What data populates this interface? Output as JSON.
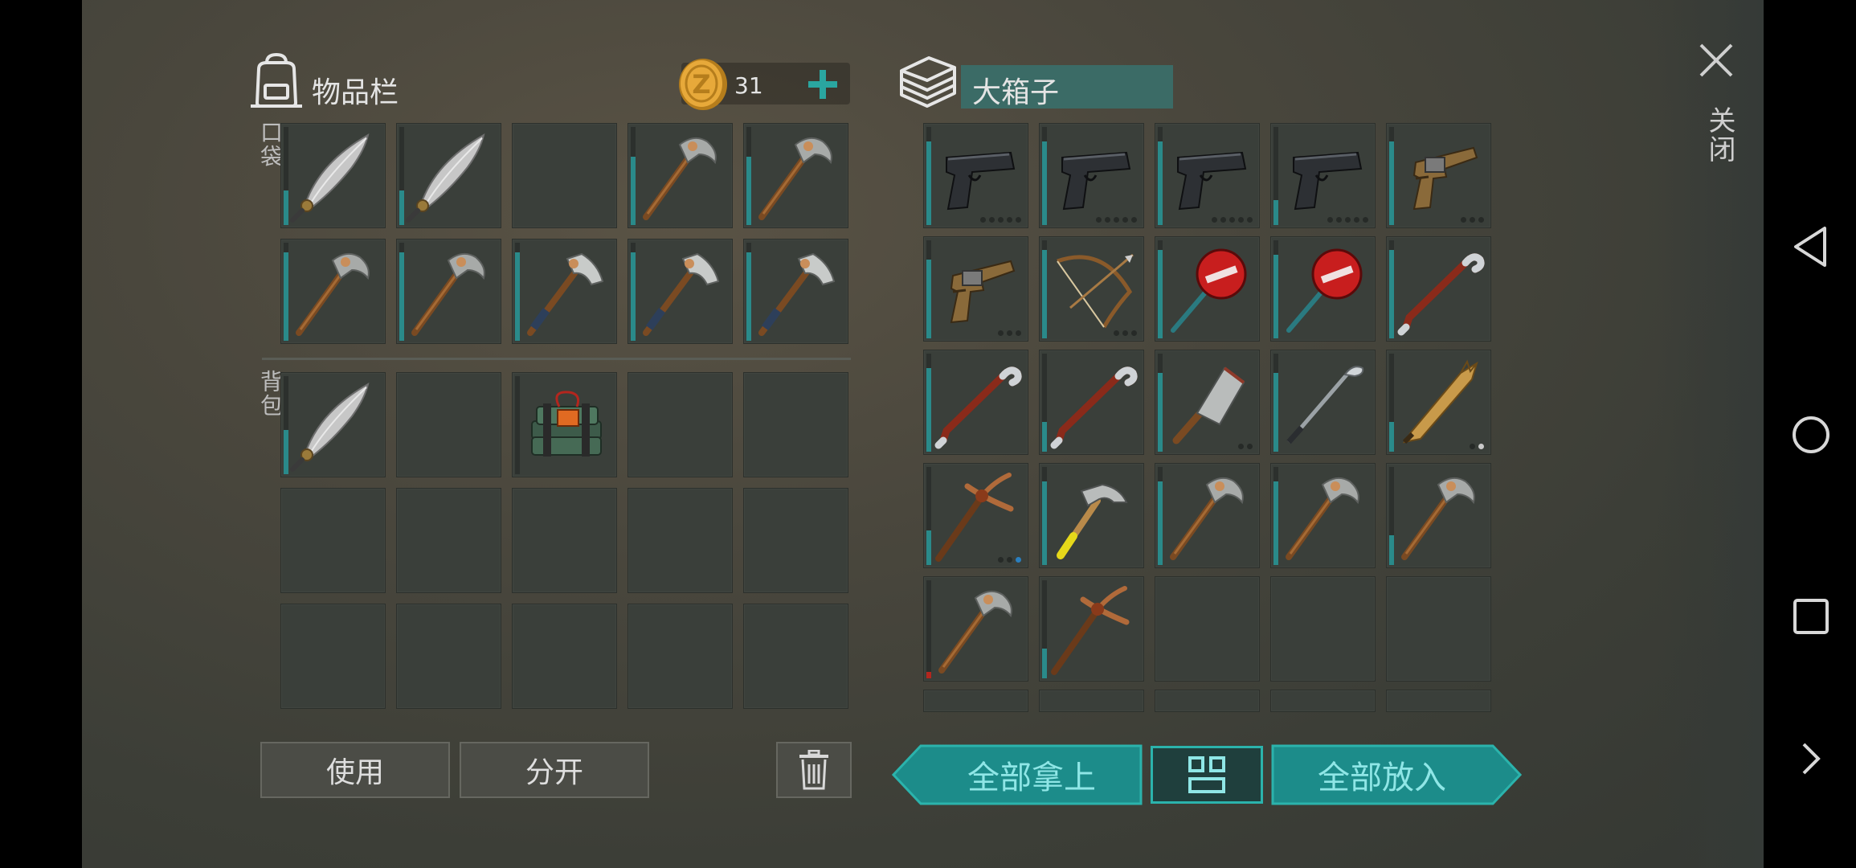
{
  "inventory": {
    "title": "物品栏",
    "coins": "31",
    "pocket_label": "口袋",
    "backpack_label": "背包",
    "pocket_slots": [
      {
        "item": "machete-icon",
        "dur": 0.35
      },
      {
        "item": "machete-icon",
        "dur": 0.35
      },
      {
        "item": "",
        "dur": 0
      },
      {
        "item": "pickaxe-icon",
        "dur": 0.7
      },
      {
        "item": "pickaxe-icon",
        "dur": 0.7
      },
      {
        "item": "pickaxe-icon",
        "dur": 0.9
      },
      {
        "item": "pickaxe-icon",
        "dur": 0.9
      },
      {
        "item": "hatchet-icon",
        "dur": 0.9
      },
      {
        "item": "hatchet-icon",
        "dur": 0.9
      },
      {
        "item": "hatchet-icon",
        "dur": 0.9
      }
    ],
    "backpack_slots": [
      {
        "item": "machete-icon",
        "dur": 0.45
      },
      {
        "item": "",
        "dur": 0
      },
      {
        "item": "c4-explosive-icon",
        "dur": 0
      },
      {
        "item": "",
        "dur": 0
      },
      {
        "item": "",
        "dur": 0
      },
      {
        "item": "",
        "dur": 0
      },
      {
        "item": "",
        "dur": 0
      },
      {
        "item": "",
        "dur": 0
      },
      {
        "item": "",
        "dur": 0
      },
      {
        "item": "",
        "dur": 0
      },
      {
        "item": "",
        "dur": 0
      },
      {
        "item": "",
        "dur": 0
      },
      {
        "item": "",
        "dur": 0
      },
      {
        "item": "",
        "dur": 0
      },
      {
        "item": "",
        "dur": 0
      }
    ],
    "use_label": "使用",
    "split_label": "分开"
  },
  "chest": {
    "title": "大箱子",
    "slots": [
      {
        "item": "pistol-icon",
        "dur": 0.85,
        "dots": [
          "d",
          "d",
          "d",
          "d",
          "d"
        ]
      },
      {
        "item": "pistol-icon",
        "dur": 0.85,
        "dots": [
          "d",
          "d",
          "d",
          "d",
          "d"
        ]
      },
      {
        "item": "pistol-icon",
        "dur": 0.85,
        "dots": [
          "d",
          "d",
          "d",
          "d",
          "d"
        ]
      },
      {
        "item": "pistol-icon",
        "dur": 0.25,
        "dots": [
          "d",
          "d",
          "d",
          "d",
          "d"
        ]
      },
      {
        "item": "flare-gun-icon",
        "dur": 0.85,
        "dots": [
          "d",
          "d",
          "d"
        ]
      },
      {
        "item": "flare-gun-icon",
        "dur": 0.8,
        "dots": [
          "d",
          "d",
          "d"
        ]
      },
      {
        "item": "bow-icon",
        "dur": 0.9,
        "dots": [
          "d",
          "d",
          "d"
        ]
      },
      {
        "item": "stop-sign-axe-icon",
        "dur": 0.9,
        "dots": []
      },
      {
        "item": "stop-sign-axe-icon",
        "dur": 0.85,
        "dots": []
      },
      {
        "item": "crowbar-icon",
        "dur": 0.9,
        "dots": []
      },
      {
        "item": "crowbar-icon",
        "dur": 0.85,
        "dots": []
      },
      {
        "item": "crowbar-icon",
        "dur": 0.3,
        "dots": []
      },
      {
        "item": "cleaver-icon",
        "dur": 0.8,
        "dots": [
          "d",
          "d"
        ]
      },
      {
        "item": "golf-club-icon",
        "dur": 0.8,
        "dots": []
      },
      {
        "item": "broken-bat-icon",
        "dur": 0.3,
        "dots": [
          "d",
          "w"
        ]
      },
      {
        "item": "spiked-pickaxe-icon",
        "dur": 0.35,
        "dots": [
          "d",
          "d",
          "b"
        ]
      },
      {
        "item": "hammer-icon",
        "dur": 0.85,
        "dots": []
      },
      {
        "item": "pickaxe-icon",
        "dur": 0.85,
        "dots": []
      },
      {
        "item": "pickaxe-icon",
        "dur": 0.85,
        "dots": []
      },
      {
        "item": "pickaxe-icon",
        "dur": 0.3,
        "dots": []
      },
      {
        "item": "pickaxe-icon",
        "dur": 0.05,
        "red": true,
        "dots": []
      },
      {
        "item": "spiked-pickaxe-icon",
        "dur": 0.3,
        "dots": []
      },
      {
        "item": "",
        "dur": 0,
        "dots": []
      },
      {
        "item": "",
        "dur": 0,
        "dots": []
      },
      {
        "item": "",
        "dur": 0,
        "dots": []
      }
    ],
    "take_all_label": "全部拿上",
    "put_all_label": "全部放入"
  },
  "close_label": "关闭",
  "colors": {
    "teal": "#1f8f8f",
    "accent_text": "#8fe6e6"
  }
}
